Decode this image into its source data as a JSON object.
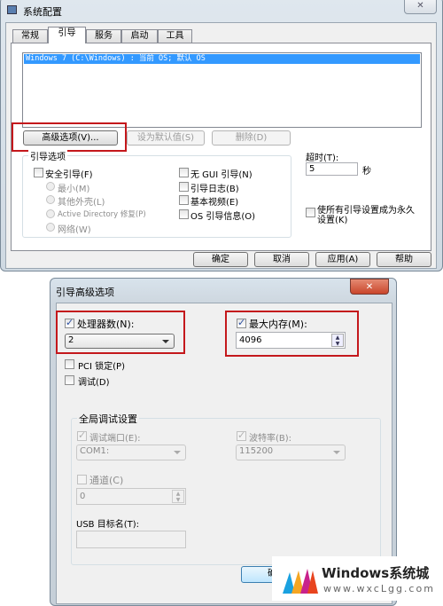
{
  "sys_config": {
    "title": "系统配置",
    "tabs": [
      "常规",
      "引导",
      "服务",
      "启动",
      "工具"
    ],
    "active_tab": "引导",
    "os_list": [
      "Windows 7 (C:\\Windows) : 当前 OS; 默认 OS"
    ],
    "buttons": {
      "advanced": "高级选项(V)...",
      "set_default": "设为默认值(S)",
      "delete": "删除(D)"
    },
    "boot_options": {
      "title": "引导选项",
      "safe_boot": "安全引导(F)",
      "radios": [
        "最小(M)",
        "其他外壳(L)",
        "Active Directory 修复(P)",
        "网络(W)"
      ],
      "right": [
        "无 GUI 引导(N)",
        "引导日志(B)",
        "基本视频(E)",
        "OS 引导信息(O)"
      ]
    },
    "timeout": {
      "label": "超时(T):",
      "value": "5",
      "unit": "秒"
    },
    "permanent": "使所有引导设置成为永久设置(K)",
    "footer": [
      "确定",
      "取消",
      "应用(A)",
      "帮助"
    ]
  },
  "advanced": {
    "title": "引导高级选项",
    "processors": {
      "label": "处理器数(N):",
      "checked": true,
      "value": "2"
    },
    "max_memory": {
      "label": "最大内存(M):",
      "checked": true,
      "value": "4096"
    },
    "pci_lock": {
      "label": "PCI 锁定(P)",
      "checked": false
    },
    "debug": {
      "label": "调试(D)",
      "checked": false
    },
    "global_debug": {
      "title": "全局调试设置",
      "debug_port": {
        "label": "调试端口(E):",
        "value": "COM1:"
      },
      "baud_rate": {
        "label": "波特率(B):",
        "value": "115200"
      },
      "channel": {
        "label": "通道(C)",
        "value": "0"
      },
      "usb_target": {
        "label": "USB 目标名(T):",
        "value": ""
      }
    },
    "ok": "确定"
  },
  "watermark": {
    "brand": "Windows系统城",
    "url": "www.wxcLgg.com"
  },
  "colors": {
    "selection": "#3399ff",
    "highlight": "#c4181c",
    "close": "#c9462c"
  }
}
